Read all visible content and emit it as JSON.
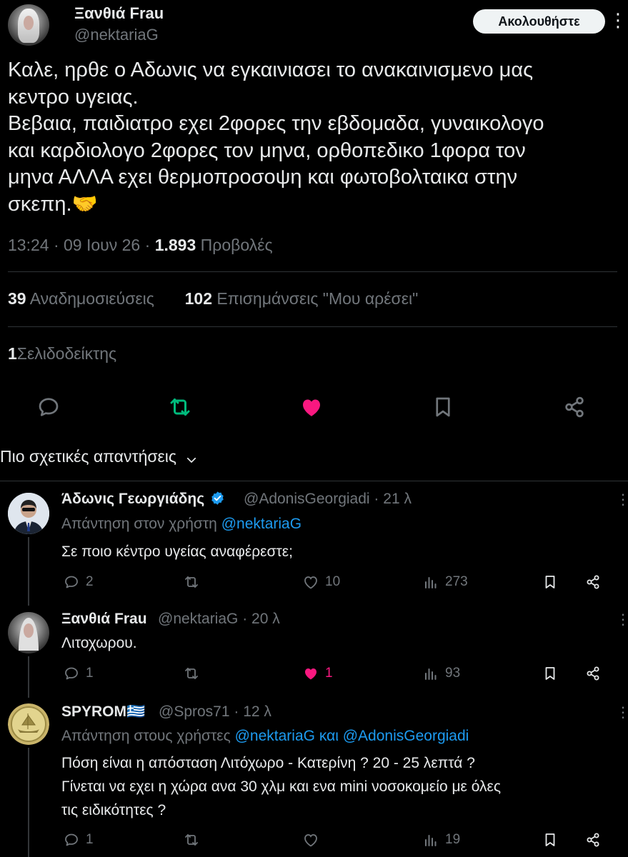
{
  "tweet": {
    "author_name": "Ξανθιά Frau",
    "author_handle": "@nektariaG",
    "follow_label": "Ακολουθήστε",
    "text": "Καλε, ηρθε ο Αδωνις να εγκαινιασει το ανακαινισμενο μας\nκεντρο υγειας.\nΒεβαια, παιδιατρο εχει 2φορες την εβδομαδα, γυναικολογο\nκαι καρδιολογο 2φορες τον μηνα, ορθοπεδικο 1φορα τον\nμηνα ΑΛΛΑ εχει θερμοπροσοψη και φωτοβολταικα στην\nσκεπη.🤝",
    "time": "13:24",
    "date": "09 Ιουν 26",
    "views_count": "1.893",
    "views_label": "Προβολές",
    "reposts_count": "39",
    "reposts_label": "Αναδημοσιεύσεις",
    "likes_count": "102",
    "likes_label": "Επισημάνσεις \"Μου αρέσει\"",
    "bookmarks_count": "1",
    "bookmarks_label": "Σελιδοδείκτης"
  },
  "actions": {
    "icons": [
      "reply-icon",
      "repost-icon",
      "like-icon",
      "bookmark-icon",
      "share-icon"
    ],
    "repost_color": "#00ba7c",
    "like_color": "#f91880"
  },
  "sort": {
    "label": "Πιο σχετικές απαντήσεις"
  },
  "replies": [
    {
      "name": "Άδωνις Γεωργιάδης",
      "verified": true,
      "handle": "@AdonisGeorgiadi",
      "time": "21 λ",
      "reply_prefix": "Απάντηση στον χρήστη",
      "reply_to": "@nektariaG",
      "reply_conj": "",
      "reply_to2": "",
      "text": "Σε ποιο κέντρο υγείας αναφέρεστε;",
      "replies": "2",
      "reposts": "",
      "likes": "10",
      "views": "273"
    },
    {
      "name": "Ξανθιά Frau",
      "verified": false,
      "handle": "@nektariaG",
      "time": "20 λ",
      "text": "Λιτοχωρου.",
      "replies": "1",
      "reposts": "",
      "likes": "1",
      "liked": true,
      "views": "93"
    },
    {
      "name": "SPYROM🇬🇷",
      "verified": false,
      "handle": "@Spros71",
      "time": "12 λ",
      "reply_prefix": "Απάντηση στους χρήστες",
      "reply_to": "@nektariaG",
      "reply_conj": "και",
      "reply_to2": "@AdonisGeorgiadi",
      "text": "Πόση είναι η απόσταση  Λιτόχωρο - Κατερίνη ? 20 - 25 λεπτά ?\nΓίνεται να εχει η χώρα ανα 30 χλμ και ενα mini νοσοκομείο με όλες\nτις ειδικότητες ?",
      "replies": "1",
      "reposts": "",
      "likes": "",
      "views": "19"
    }
  ],
  "colors": {
    "background": "#000000",
    "text": "#e7e9ea",
    "muted": "#71767b",
    "link": "#1d9bf0",
    "verified": "#1d9bf0"
  }
}
